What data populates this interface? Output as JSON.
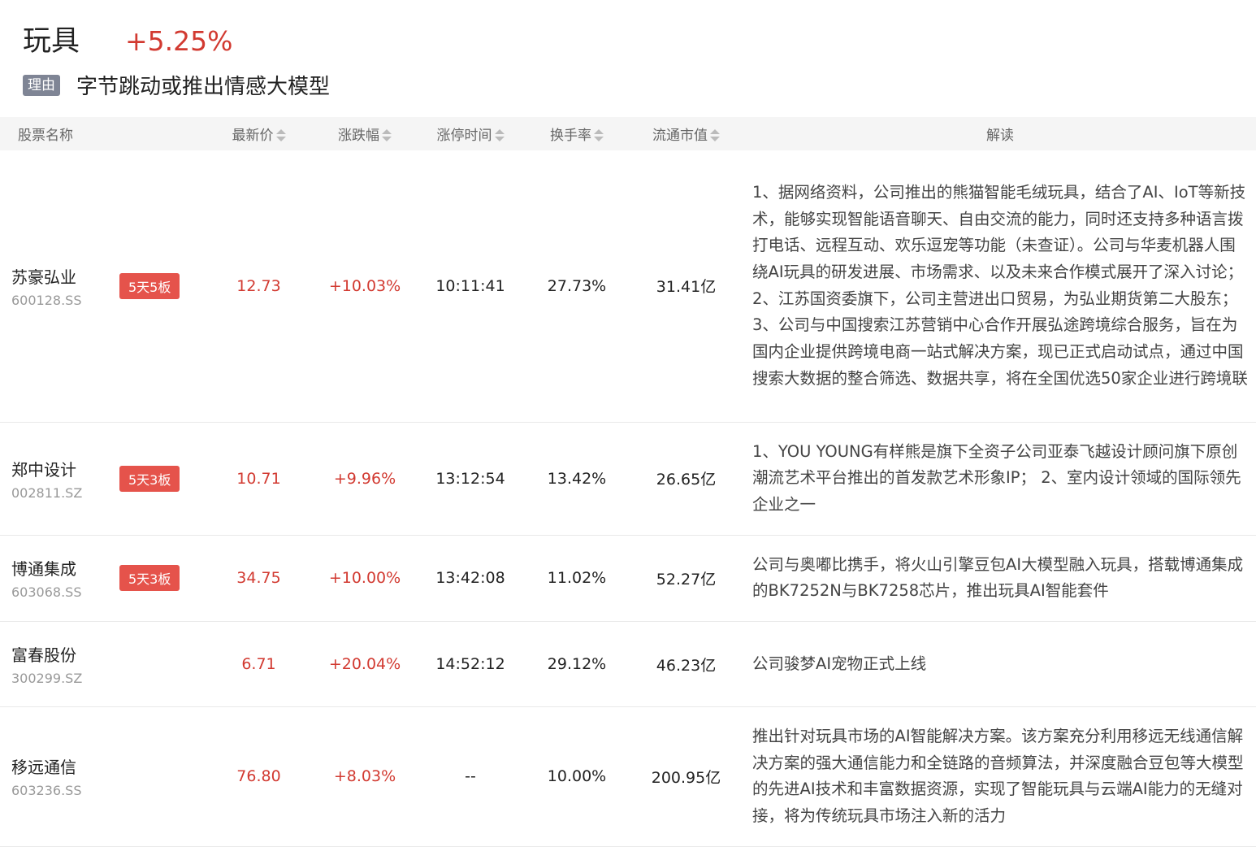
{
  "header": {
    "sector_name": "玩具",
    "sector_change": "+5.25%",
    "reason_tag": "理由",
    "reason_text": "字节跳动或推出情感大模型"
  },
  "table": {
    "columns": [
      "股票名称",
      "最新价",
      "涨跌幅",
      "涨停时间",
      "换手率",
      "流通市值",
      "解读"
    ],
    "rows": [
      {
        "name": "苏豪弘业",
        "code": "600128.SS",
        "badge": "5天5板",
        "price": "12.73",
        "change": "+10.03%",
        "limit_time": "10:11:41",
        "turnover": "27.73%",
        "market_cap": "31.41亿",
        "description": "1、据网络资料，公司推出的熊猫智能毛绒玩具，结合了AI、IoT等新技术，能够实现智能语音聊天、自由交流的能力，同时还支持多种语言拨打电话、远程互动、欢乐逗宠等功能（未查证）。公司与华麦机器人围绕AI玩具的研发进展、市场需求、以及未来合作模式展开了深入讨论； 2、江苏国资委旗下，公司主营进出口贸易，为弘业期货第二大股东； 3、公司与中国搜索江苏营销中心合作开展弘途跨境综合服务，旨在为国内企业提供跨境电商一站式解决方案，现已正式启动试点，通过中国搜索大数据的整合筛选、数据共享，将在全国优选50家企业进行跨境联"
      },
      {
        "name": "郑中设计",
        "code": "002811.SZ",
        "badge": "5天3板",
        "price": "10.71",
        "change": "+9.96%",
        "limit_time": "13:12:54",
        "turnover": "13.42%",
        "market_cap": "26.65亿",
        "description": "1、YOU YOUNG有样熊是旗下全资子公司亚泰飞越设计顾问旗下原创潮流艺术平台推出的首发款艺术形象IP； 2、室内设计领域的国际领先企业之一"
      },
      {
        "name": "博通集成",
        "code": "603068.SS",
        "badge": "5天3板",
        "price": "34.75",
        "change": "+10.00%",
        "limit_time": "13:42:08",
        "turnover": "11.02%",
        "market_cap": "52.27亿",
        "description": "公司与奥嘟比携手，将火山引擎豆包AI大模型融入玩具，搭载博通集成的BK7252N与BK7258芯片，推出玩具AI智能套件"
      },
      {
        "name": "富春股份",
        "code": "300299.SZ",
        "badge": "",
        "price": "6.71",
        "change": "+20.04%",
        "limit_time": "14:52:12",
        "turnover": "29.12%",
        "market_cap": "46.23亿",
        "description": "公司骏梦AI宠物正式上线"
      },
      {
        "name": "移远通信",
        "code": "603236.SS",
        "badge": "",
        "price": "76.80",
        "change": "+8.03%",
        "limit_time": "--",
        "turnover": "10.00%",
        "market_cap": "200.95亿",
        "description": "推出针对玩具市场的AI智能解决方案。该方案充分利用移远无线通信解决方案的强大通信能力和全链路的音频算法，并深度融合豆包等大模型的先进AI技术和丰富数据资源，实现了智能玩具与云端AI能力的无缝对接，将为传统玩具市场注入新的活力"
      }
    ]
  },
  "colors": {
    "up": "#d23a31",
    "badge": "#e5534b",
    "reason_tag": "#7f8595",
    "header_bg": "#f5f5f5"
  },
  "icons": {
    "sort": "sort-arrows-icon"
  }
}
